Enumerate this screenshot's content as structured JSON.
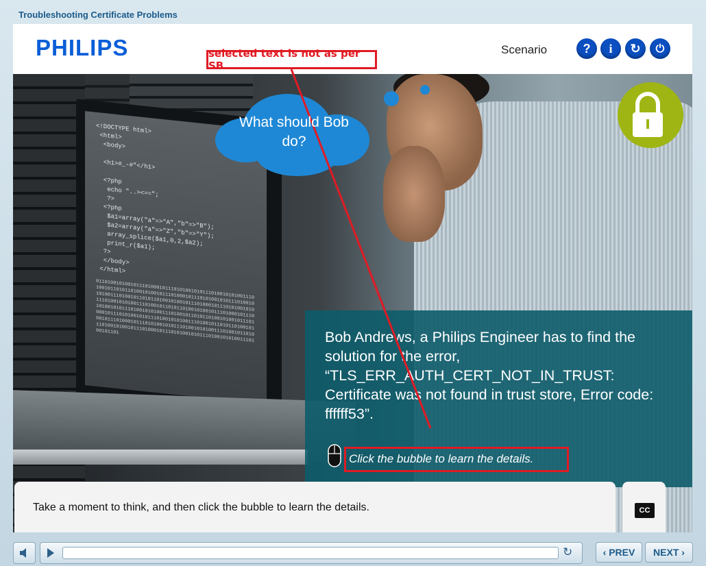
{
  "course": {
    "title": "Troubleshooting Certificate Problems"
  },
  "header": {
    "logo": "PHILIPS",
    "section": "Scenario",
    "buttons": [
      {
        "icon": "help-icon",
        "glyph": "?"
      },
      {
        "icon": "info-icon",
        "glyph": "i"
      },
      {
        "icon": "refresh-icon",
        "glyph": "↻"
      },
      {
        "icon": "power-icon",
        "glyph": "⏻"
      }
    ]
  },
  "scene": {
    "bubble_text": "What should Bob do?",
    "code_lines": "<!DOCTYPE html>\n <html>\n  <body>\n\n  <h1>#_-#\"</h1>\n\n  <?php\n   echo \"..><==\";\n   ?>\n  <?php\n   $a1=array(\"a\"=>\"A\",\"b\"=>\"B\");\n   $a2=array(\"a\"=>\"Z\",\"b\"=>\"Y\");\n   array_splice($a1,0,2,$a2);\n   print_r($a1);\n  ?>\n  </body>\n </html>",
    "binary": "0110100101001011101000101110101001010111010010101001110100101101011010010100101110100010111010100101011101001010100111010010110101101001010010111010001011101010010101110100101010011101001011010110100101001011101000101110101001010111010010101001110100101101011010010100101110100010111010100101011101001010100111010010110101101001010010111010001011101010010101110100101010011101001011010110100101001011101000101110101001010111010010101001110100101101"
  },
  "info_panel": {
    "text": "Bob Andrews, a Philips Engineer has to find the solution for the error, “TLS_ERR_AUTH_CERT_NOT_IN_TRUST: Certificate was not found in trust store, Error code: ffffff53”.",
    "hint": "Click the bubble to learn the details."
  },
  "annotation": {
    "label": "selected text is not as per SB"
  },
  "caption": {
    "text": "Take a moment to think, and then click the bubble to learn the details.",
    "cc_label": "CC"
  },
  "player": {
    "progress": 0,
    "prev_label": "‹ PREV",
    "next_label": "NEXT ›"
  },
  "colors": {
    "brand_blue": "#0b5ed7",
    "bubble_blue": "#1e88d6",
    "panel_teal": "#0d5c6a",
    "lock_green": "#9fb513",
    "annotation_red": "#e01b24"
  }
}
